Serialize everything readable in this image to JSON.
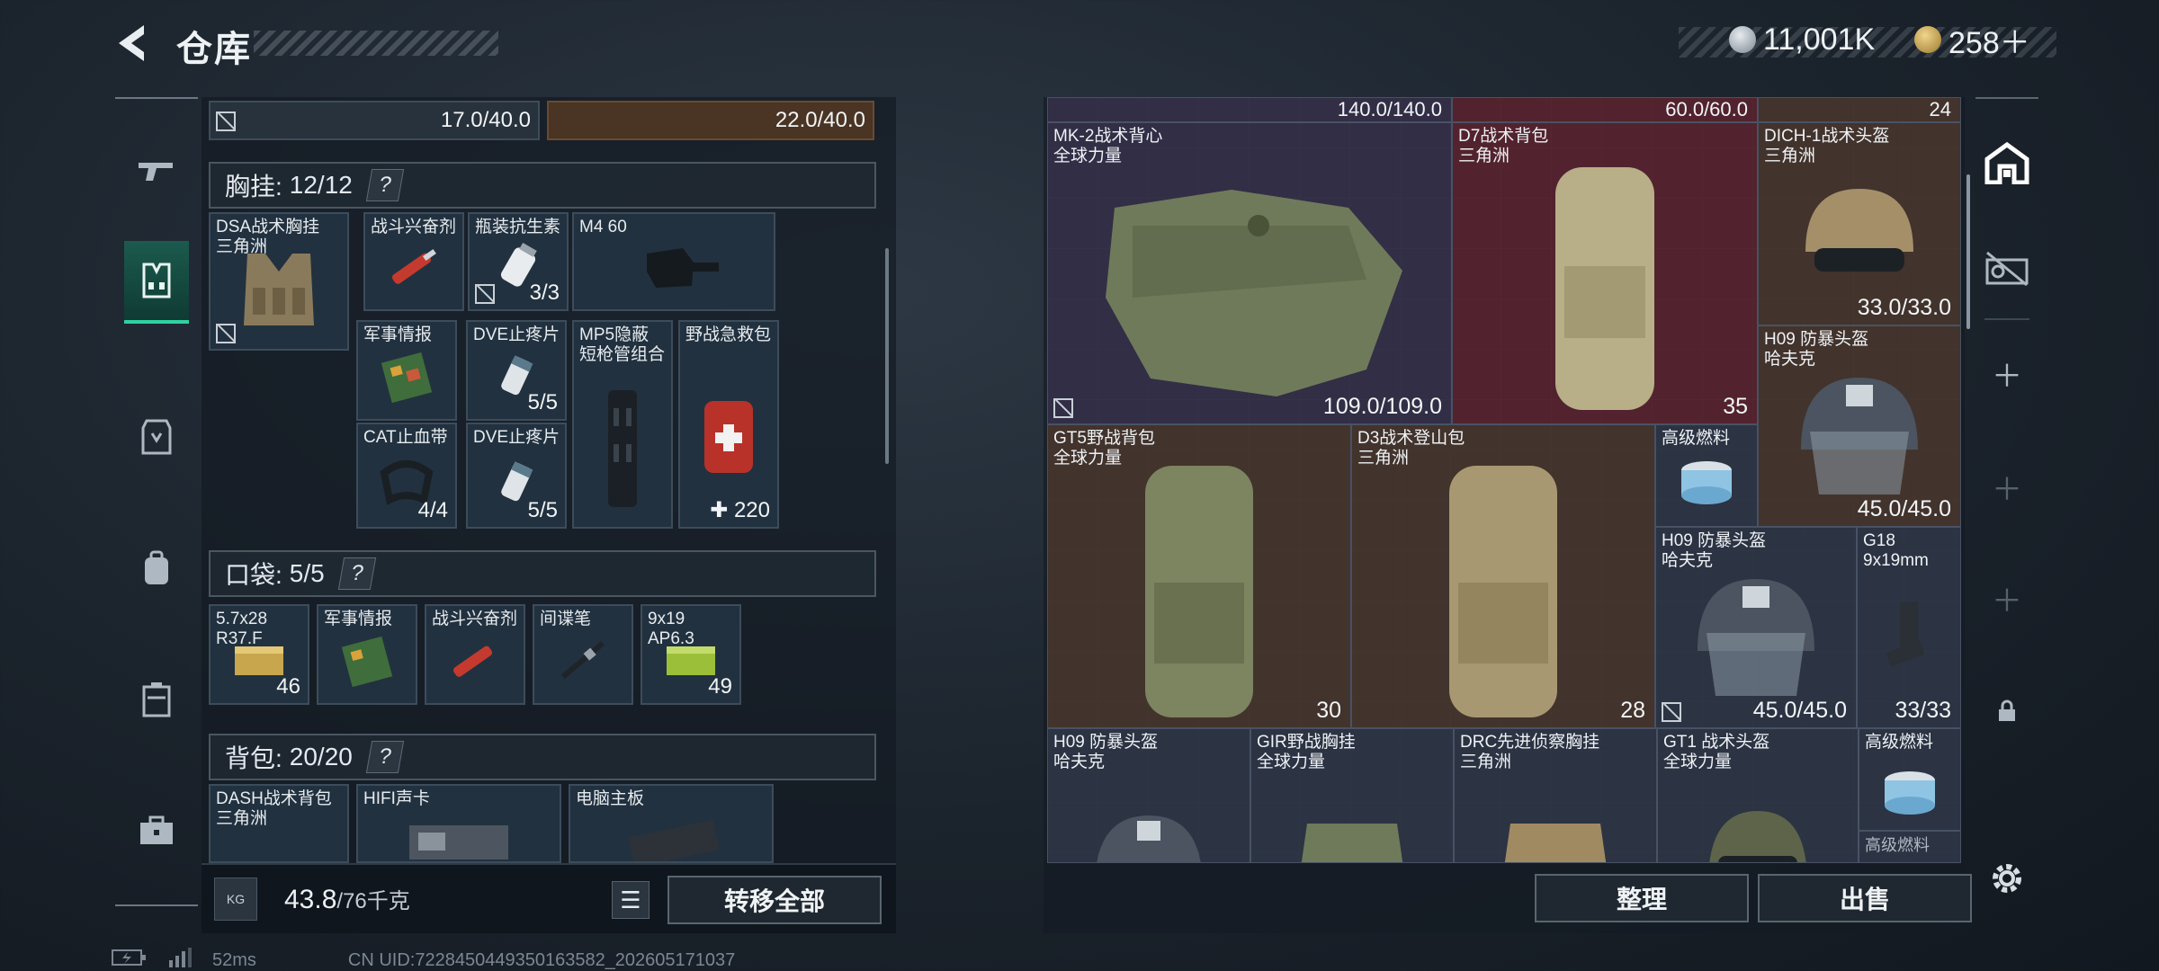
{
  "header": {
    "title": "仓库",
    "currency": [
      {
        "icon": "silver-coin-icon",
        "value": "11,001K"
      },
      {
        "icon": "gold-coin-icon",
        "value": "258＋"
      }
    ]
  },
  "left_rail": {
    "items": [
      {
        "icon": "gun-icon",
        "label": ""
      },
      {
        "icon": "chest-rig-icon",
        "label": ""
      },
      {
        "icon": "vest-icon",
        "label": ""
      },
      {
        "icon": "backpack-icon",
        "label": ""
      },
      {
        "icon": "case-icon",
        "label": ""
      },
      {
        "icon": "toolbox-icon",
        "label": ""
      }
    ]
  },
  "left_panel": {
    "top_cells": [
      {
        "value": "17.0/40.0"
      },
      {
        "value": "22.0/40.0"
      }
    ],
    "chest": {
      "label": "胸挂:",
      "count": "12/12",
      "help": "?",
      "items": [
        {
          "name": "DSA战术胸挂\n三角洲",
          "qty": ""
        },
        {
          "name": "战斗兴奋剂",
          "qty": ""
        },
        {
          "name": "瓶装抗生素",
          "qty": "3/3"
        },
        {
          "name": "M4 60",
          "qty": ""
        },
        {
          "name": "军事情报",
          "qty": ""
        },
        {
          "name": "DVE止疼片",
          "qty": "5/5"
        },
        {
          "name": "MP5隐蔽\n短枪管组合",
          "qty": ""
        },
        {
          "name": "野战急救包",
          "qty": "✚ 220"
        },
        {
          "name": "CAT止血带",
          "qty": "4/4"
        },
        {
          "name": "DVE止疼片",
          "qty": "5/5"
        }
      ]
    },
    "pocket": {
      "label": "口袋:",
      "count": "5/5",
      "help": "?",
      "items": [
        {
          "name": "5.7x28\nR37.F",
          "qty": "46"
        },
        {
          "name": "军事情报",
          "qty": ""
        },
        {
          "name": "战斗兴奋剂",
          "qty": ""
        },
        {
          "name": "间谍笔",
          "qty": ""
        },
        {
          "name": "9x19\nAP6.3",
          "qty": "49"
        }
      ]
    },
    "backpack": {
      "label": "背包:",
      "count": "20/20",
      "help": "?",
      "items": [
        {
          "name": "DASH战术背包\n三角洲"
        },
        {
          "name": "HIFI声卡"
        },
        {
          "name": "电脑主板"
        }
      ]
    },
    "bottom": {
      "weight_icon": "KG",
      "weight_current": "43.8",
      "weight_max": "/76千克",
      "transfer_all": "转移全部"
    }
  },
  "right_panel": {
    "top_strip": [
      "140.0/140.0",
      "60.0/60.0",
      "24"
    ],
    "items": [
      {
        "name": "MK-2战术背心\n全球力量",
        "qty": "109.0/109.0",
        "color": "purple"
      },
      {
        "name": "D7战术背包\n三角洲",
        "qty": "35",
        "color": "red"
      },
      {
        "name": "DICH-1战术头盔\n三角洲",
        "qty": "33.0/33.0",
        "color": "brown"
      },
      {
        "name": "H09 防暴头盔\n哈夫克",
        "qty": "45.0/45.0",
        "color": "brown"
      },
      {
        "name": "GT5野战背包\n全球力量",
        "qty": "30",
        "color": "brown"
      },
      {
        "name": "D3战术登山包\n三角洲",
        "qty": "28",
        "color": "brown"
      },
      {
        "name": "高级燃料",
        "qty": "",
        "color": "slate"
      },
      {
        "name": "H09 防暴头盔\n哈夫克",
        "qty": "45.0/45.0",
        "color": "slate"
      },
      {
        "name": "G18\n9x19mm",
        "qty": "33/33",
        "color": "slate"
      },
      {
        "name": "H09 防暴头盔\n哈夫克",
        "qty": "",
        "color": "slate"
      },
      {
        "name": "GIR野战胸挂\n全球力量",
        "qty": "",
        "color": "slate"
      },
      {
        "name": "DRC先进侦察胸挂\n三角洲",
        "qty": "",
        "color": "slate"
      },
      {
        "name": "GT1 战术头盔\n全球力量",
        "qty": "",
        "color": "slate"
      },
      {
        "name": "高级燃料",
        "qty": "",
        "color": "slate"
      },
      {
        "name": "高级燃料",
        "qty": "",
        "color": "slate"
      }
    ],
    "sort_button": "整理",
    "sell_button": "出售"
  },
  "right_rail": {
    "items": [
      "warehouse-icon",
      "vehicle-icon",
      "plus-icon",
      "plus-icon",
      "plus-icon",
      "lock-icon",
      "gear-icon"
    ]
  },
  "footer": {
    "ping": "52ms",
    "uid": "CN UID:7228450449350163582_202605171037"
  }
}
